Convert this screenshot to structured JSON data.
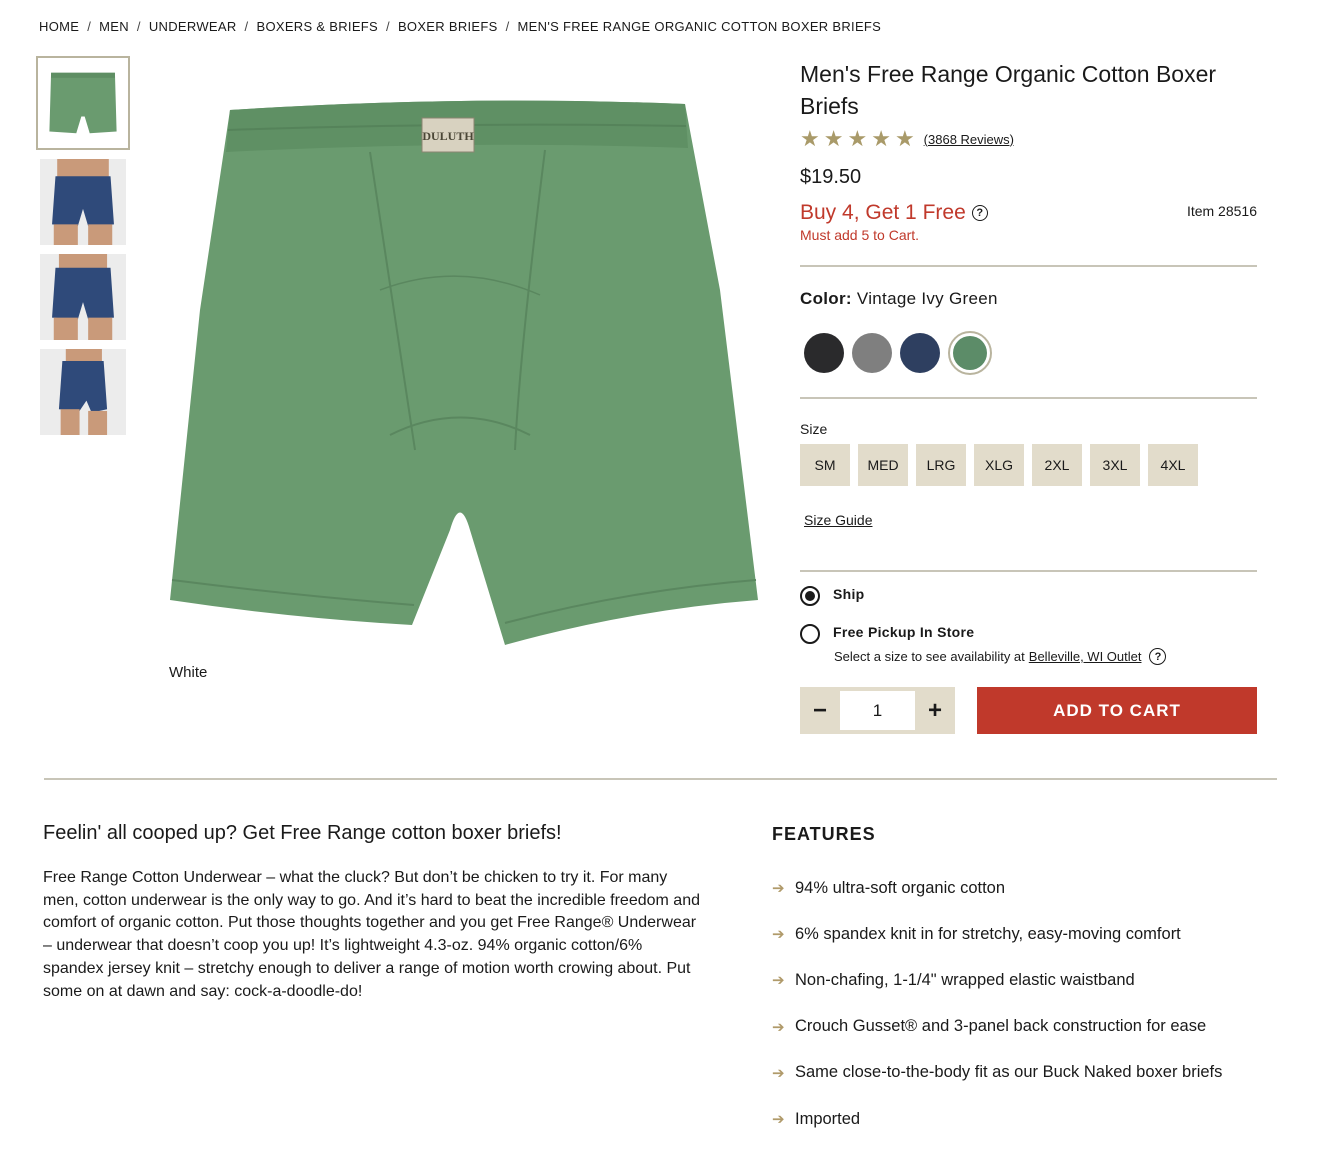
{
  "breadcrumb": [
    "HOME",
    "MEN",
    "UNDERWEAR",
    "BOXERS & BRIEFS",
    "BOXER BRIEFS",
    "MEN'S FREE RANGE ORGANIC COTTON BOXER BRIEFS"
  ],
  "breadcrumb_separator": "/",
  "gallery": {
    "thumbnails": [
      "product-flat-green",
      "model-front-navy",
      "model-front-navy-2",
      "model-side-navy"
    ],
    "caption": "White",
    "brand_label": "DULUTH"
  },
  "product": {
    "title": "Men's Free Range Organic Cotton Boxer Briefs",
    "rating": 5,
    "reviews": "(3868 Reviews)",
    "price": "$19.50",
    "promo": "Buy 4, Get 1 Free",
    "promo_note": "Must add 5 to Cart.",
    "item_number": "Item 28516",
    "color_label": "Color:",
    "color_value": "Vintage Ivy Green",
    "colors": [
      {
        "name": "Black",
        "hex": "#2a2a2c"
      },
      {
        "name": "Gray",
        "hex": "#7f7f7f"
      },
      {
        "name": "Navy",
        "hex": "#2e3f60"
      },
      {
        "name": "Vintage Ivy Green",
        "hex": "#5c8c68"
      }
    ],
    "size_label": "Size",
    "sizes": [
      "SM",
      "MED",
      "LRG",
      "XLG",
      "2XL",
      "3XL",
      "4XL"
    ],
    "size_guide": "Size Guide",
    "fulfillment": {
      "ship_label": "Ship",
      "pickup_label": "Free Pickup In Store",
      "pickup_note": "Select a size to see availability at",
      "store_link": "Belleville, WI Outlet"
    },
    "quantity": "1",
    "minus": "−",
    "plus": "+",
    "add_to_cart": "ADD TO CART",
    "help_glyph": "?"
  },
  "description": {
    "heading": "Feelin' all cooped up? Get Free Range cotton boxer briefs!",
    "body": "Free Range Cotton Underwear – what the cluck? But don’t be chicken to try it. For many men, cotton underwear is the only way to go. And it’s hard to beat the incredible freedom and comfort of organic cotton. Put those thoughts together and you get Free Range® Underwear – underwear that doesn’t coop you up! It’s lightweight 4.3-oz. 94% organic cotton/6% spandex jersey knit – stretchy enough to deliver a range of motion worth crowing about. Put some on at dawn and say: cock-a-doodle-do!"
  },
  "features": {
    "heading": "FEATURES",
    "items": [
      "94% ultra-soft organic cotton",
      "6% spandex knit in for stretchy, easy-moving comfort",
      "Non-chafing, 1-1/4\" wrapped elastic waistband",
      "Crouch Gusset® and 3-panel back construction for ease",
      "Same close-to-the-body fit as our Buck Naked boxer briefs",
      "Imported"
    ]
  },
  "colors": {
    "accent_red": "#c0392b",
    "star_gold": "#a99a69",
    "chip_beige": "#e2dccb",
    "divider": "#c8c5b8",
    "product_green": "#6a9b6f",
    "navy": "#2f4a7a"
  }
}
